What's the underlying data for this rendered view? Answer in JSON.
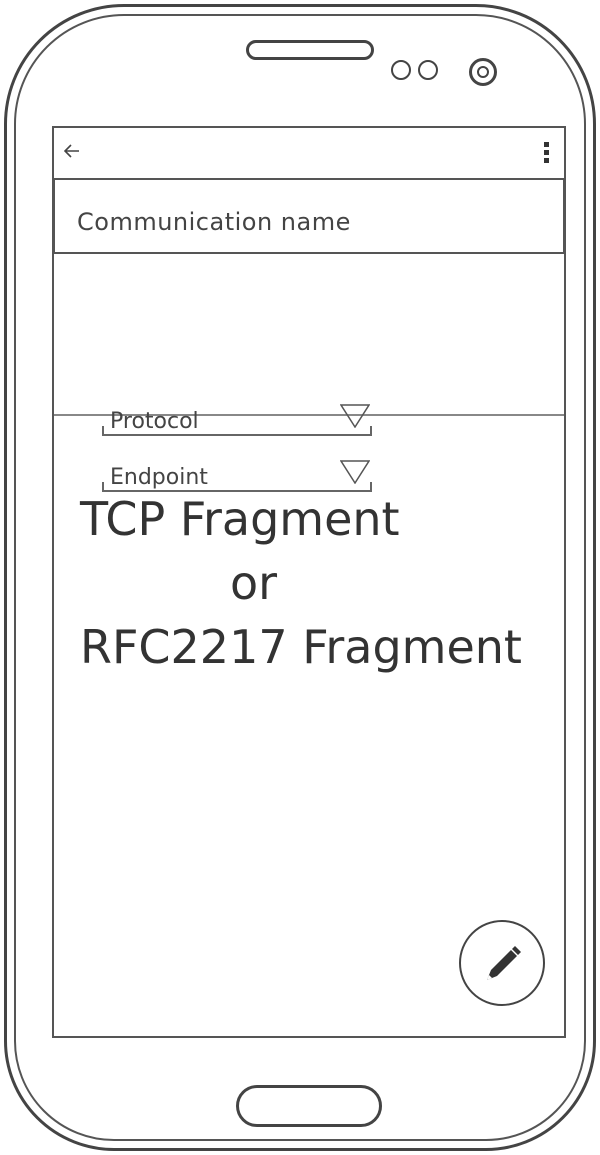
{
  "appbar": {
    "back_icon": "arrow-back-icon",
    "menu_icon": "more-vert-icon"
  },
  "form": {
    "name_label": "Communication name",
    "protocol_label": "Protocol",
    "endpoint_label": "Endpoint",
    "dropdown_icon": "triangle-down-icon"
  },
  "content": {
    "line1": "TCP Fragment",
    "line2": "or",
    "line3": "RFC2217 Fragment"
  },
  "fab": {
    "icon": "pencil-icon"
  }
}
